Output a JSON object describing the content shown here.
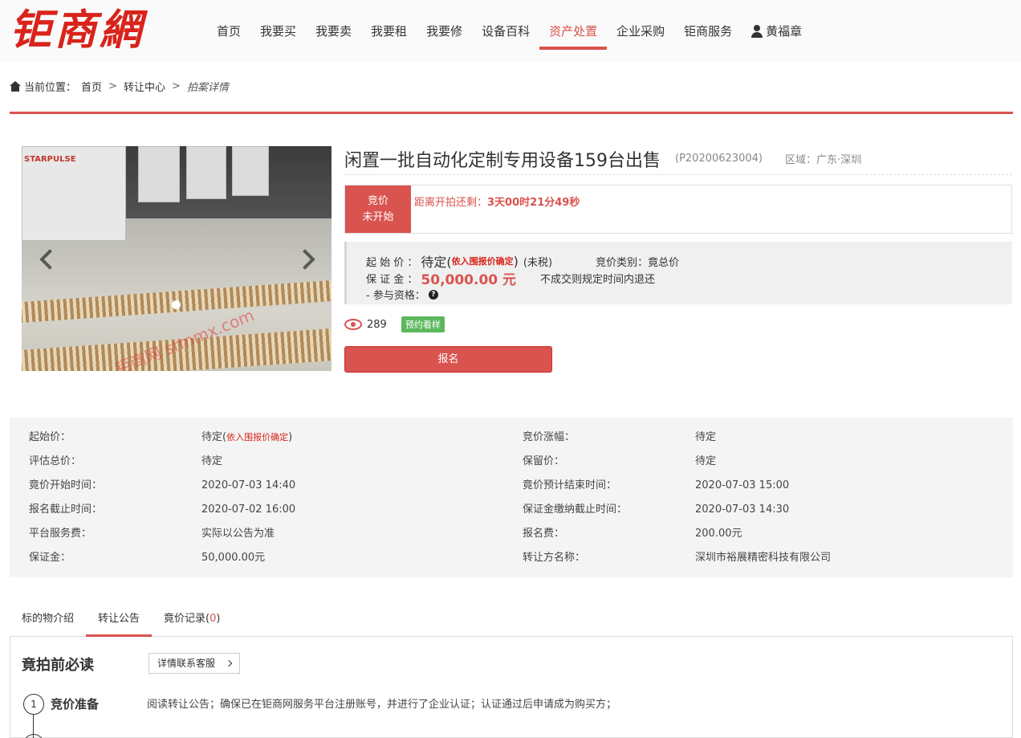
{
  "header": {
    "logo": "钜商網",
    "nav": [
      "首页",
      "我要买",
      "我要卖",
      "我要租",
      "我要修",
      "设备百科",
      "资产处置",
      "企业采购",
      "钜商服务"
    ],
    "active_nav": "资产处置",
    "user_name": "黄福章",
    "icons": [
      "home-icon",
      "user-icon"
    ]
  },
  "breadcrumb": {
    "label": "当前位置：",
    "items": [
      "首页",
      "转让中心",
      "拍案详情"
    ],
    "separator": ">"
  },
  "photo": {
    "brand_text": "STARPULSE",
    "watermark": "钜商网 srmmx.com"
  },
  "listing": {
    "title": "闲置一批自动化定制专用设备159台出售",
    "code": "(P20200623004)",
    "region": "区域：广东·深圳",
    "status_line1": "竞价",
    "status_line2": "未开始",
    "countdown_label": "距离开拍还剩：",
    "countdown_value": "3天00时21分49秒",
    "start_price_label": "起 始 价 ：",
    "start_price_value": "待定(",
    "start_price_note": "依入围报价确定",
    "start_price_close": ")",
    "tax": "(未税)",
    "bid_type": "竞价类别：竟总价",
    "deposit_label": "保 证 金 ：",
    "deposit_value": "50,000.00 元",
    "deposit_note": "不成交则规定时间内退还",
    "qualification_label": "- 参与资格：",
    "views": "289",
    "appointment_badge": "预约看样",
    "signup_button": "报名"
  },
  "info": {
    "rows": [
      {
        "l_label": "起始价：",
        "l_value": "待定(",
        "l_note": "依入围报价确定",
        "l_close": ")",
        "r_label": "竞价涨幅：",
        "r_value": "待定"
      },
      {
        "l_label": "评估总价：",
        "l_value": "待定",
        "l_note": "",
        "l_close": "",
        "r_label": "保留价：",
        "r_value": "待定"
      },
      {
        "l_label": "竟价开始时间：",
        "l_value": "2020-07-03 14:40",
        "l_note": "",
        "l_close": "",
        "r_label": "竟价预计结束时间：",
        "r_value": "2020-07-03 15:00"
      },
      {
        "l_label": "报名截止时间：",
        "l_value": "2020-07-02 16:00",
        "l_note": "",
        "l_close": "",
        "r_label": "保证金缴纳截止时间：",
        "r_value": "2020-07-03 14:30"
      },
      {
        "l_label": "平台服务费：",
        "l_value": "实际以公告为准",
        "l_note": "",
        "l_close": "",
        "r_label": "报名费：",
        "r_value": "200.00元"
      },
      {
        "l_label": "保证金：",
        "l_value": "50,000.00元",
        "l_note": "",
        "l_close": "",
        "r_label": "转让方名称：",
        "r_value": "深圳市裕展精密科技有限公司"
      }
    ]
  },
  "tabs": {
    "items": [
      "标的物介绍",
      "转让公告",
      "竟价记录("
    ],
    "bid_count": "0",
    "bid_close": ")",
    "active": "转让公告"
  },
  "notice": {
    "title": "竟拍前必读",
    "contact_button": "详情联系客服",
    "step_number": "1",
    "step_title": "竞价准备",
    "step_desc": "阅读转让公告；确保已在钜商网服务平台注册账号，并进行了企业认证；认证通过后申请成为购买方；"
  },
  "colors": {
    "brand_red": "#d9534f",
    "logo_red": "#d9231b",
    "green": "#5cb85c"
  }
}
